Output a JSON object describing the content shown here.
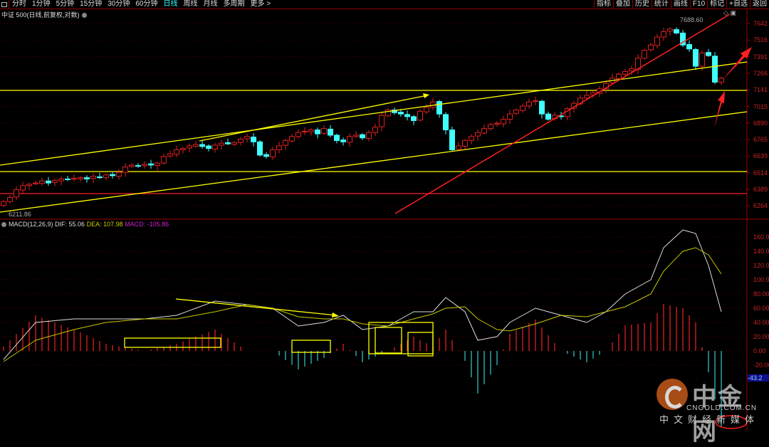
{
  "toolbar": {
    "periods": [
      "分时",
      "1分钟",
      "5分钟",
      "15分钟",
      "30分钟",
      "60分钟",
      "日线",
      "周线",
      "月线",
      "多周期",
      "更多 >"
    ],
    "active_period": "日线",
    "right_buttons": [
      "指标",
      "叠加",
      "历史",
      "统计",
      "画线",
      "F10",
      "标记",
      "+自选",
      "返回"
    ]
  },
  "chart_title": "中证 500(日线,前复权,对数)",
  "price_axis": [
    "7642",
    "7516",
    "7391",
    "7266",
    "7141",
    "7015",
    "6890",
    "6765",
    "6639",
    "6514",
    "6389",
    "6264"
  ],
  "macd_axis": [
    "160.0",
    "140.0",
    "120.0",
    "100.0",
    "80.00",
    "60.00",
    "40.00",
    "20.00",
    "0.00",
    "-20.00"
  ],
  "macd_label": {
    "name": "MACD(12,26,9)",
    "dif": "DIF: 55.06",
    "dea": "DEA: 107.98",
    "macd": "MACD: -105.86"
  },
  "macd_current_tag": "-43.2",
  "low_label": "6211.86",
  "high_label": "7688.60",
  "watermark": {
    "brand": "中金网",
    "domain": "CNGOLD.COM.CN",
    "slogan": "中文财经新媒体"
  },
  "colors": {
    "up": "#e02020",
    "down": "#40ffff",
    "dif": "#dddddd",
    "dea": "#c8c800",
    "trend_yellow": "#ffff00",
    "trend_red": "#ff2020"
  },
  "chart_data": {
    "type": "candlestick",
    "y_range": [
      6211.86,
      7688.6
    ],
    "closes": [
      6300,
      6330,
      6390,
      6420,
      6430,
      6440,
      6455,
      6440,
      6460,
      6470,
      6465,
      6475,
      6480,
      6470,
      6490,
      6480,
      6500,
      6495,
      6520,
      6560,
      6575,
      6570,
      6580,
      6575,
      6590,
      6640,
      6660,
      6690,
      6700,
      6720,
      6730,
      6715,
      6700,
      6725,
      6740,
      6735,
      6745,
      6770,
      6790,
      6750,
      6650,
      6640,
      6690,
      6720,
      6760,
      6790,
      6820,
      6830,
      6840,
      6810,
      6850,
      6800,
      6760,
      6750,
      6790,
      6800,
      6780,
      6820,
      6860,
      6950,
      6990,
      6970,
      6960,
      6940,
      6910,
      6980,
      7010,
      7050,
      6960,
      6840,
      6690,
      6720,
      6760,
      6790,
      6820,
      6850,
      6880,
      6890,
      6920,
      6960,
      6990,
      7020,
      7050,
      7060,
      6960,
      6920,
      6950,
      6940,
      7000,
      7040,
      7080,
      7100,
      7120,
      7150,
      7190,
      7230,
      7260,
      7280,
      7300,
      7380,
      7440,
      7480,
      7540,
      7580,
      7600,
      7570,
      7480,
      7450,
      7320,
      7420,
      7400,
      7200,
      7230
    ],
    "macd": {
      "anchor_index": [
        0,
        5,
        11,
        16,
        22,
        27,
        33,
        38,
        42,
        46,
        50,
        53,
        56,
        60,
        64,
        67,
        69,
        72,
        74,
        77,
        79,
        83,
        87,
        91,
        94,
        97,
        101,
        103,
        106,
        108,
        110,
        112
      ],
      "dif": [
        -12,
        40,
        45,
        45,
        45,
        50,
        70,
        65,
        60,
        35,
        40,
        50,
        30,
        35,
        55,
        55,
        75,
        55,
        15,
        20,
        40,
        60,
        50,
        40,
        55,
        80,
        100,
        145,
        170,
        165,
        120,
        55
      ],
      "dea": [
        -15,
        15,
        30,
        40,
        45,
        45,
        55,
        65,
        60,
        48,
        45,
        45,
        38,
        35,
        45,
        52,
        60,
        62,
        45,
        30,
        28,
        38,
        50,
        48,
        55,
        62,
        80,
        112,
        140,
        145,
        135,
        108
      ]
    }
  }
}
